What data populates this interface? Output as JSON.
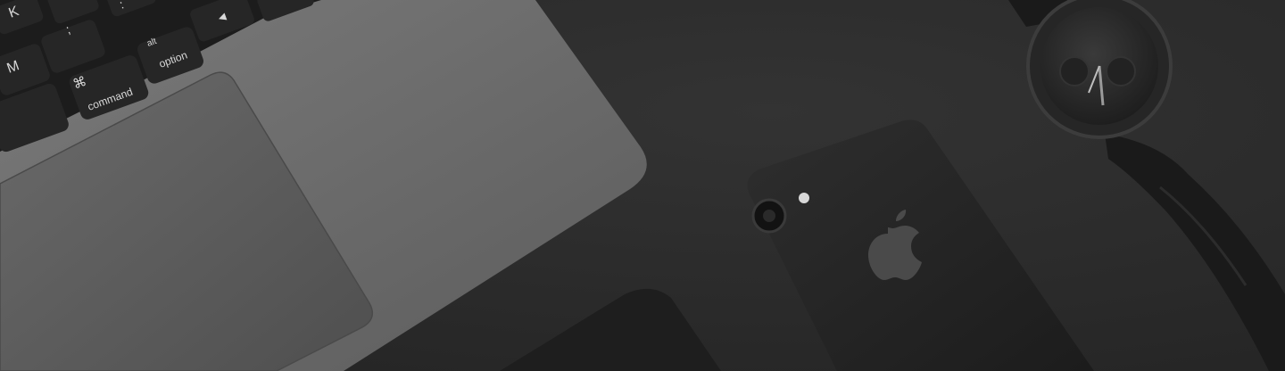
{
  "photo": {
    "subject": "desk-flatlay",
    "tone": "monochrome",
    "colors": {
      "desk": "#2b2b2b",
      "laptop": "#6c6c6c",
      "trackpad": "#5e5e5e",
      "keyboard": "#1c1c1c",
      "key": "#262626",
      "phone": "#242424",
      "watch": "#202020",
      "strap": "#1a1a1a"
    }
  },
  "keyboard": {
    "keys": {
      "k": "K",
      "m": "M",
      "semicolon": ";",
      "colon": ":",
      "arrow": "◀",
      "cmd_symbol": "⌘",
      "command": "command",
      "alt": "alt",
      "option": "option"
    }
  }
}
